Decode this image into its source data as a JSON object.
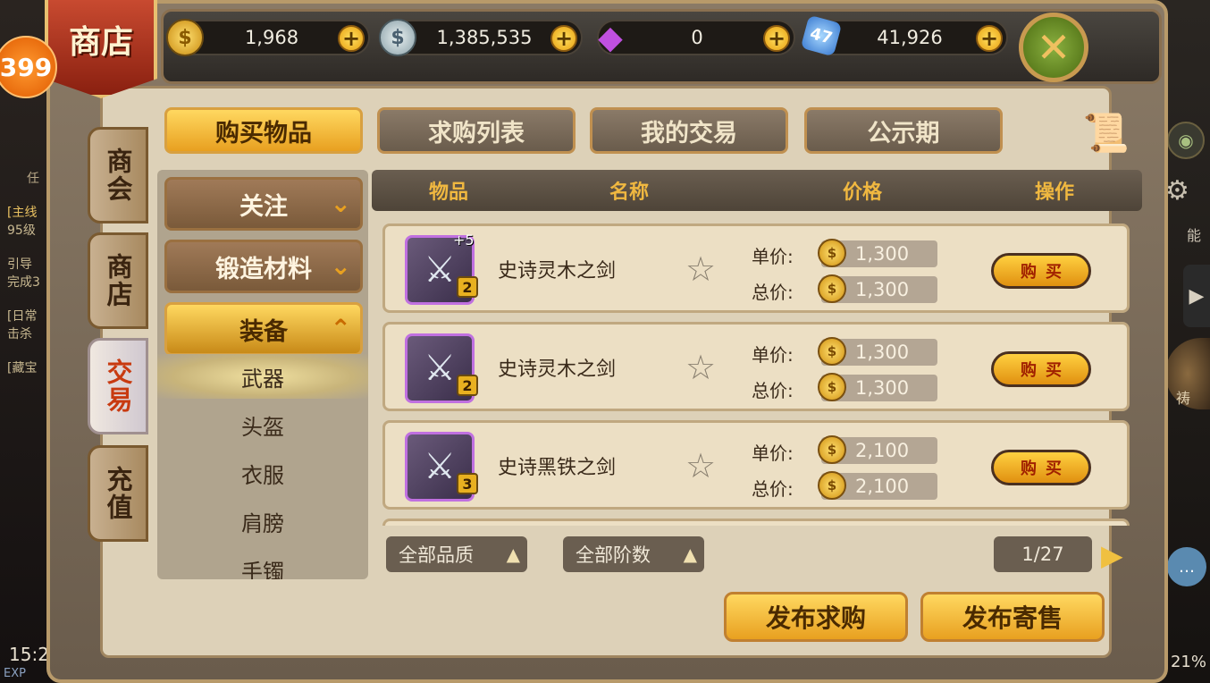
{
  "background": {
    "quests": [
      "[主线",
      "95级",
      "引导",
      "完成3",
      "[日常",
      "击杀",
      "[藏宝"
    ],
    "quest_tab": "任",
    "time": "15:2",
    "exp_label": "EXP",
    "percent": "21%",
    "right_label_1": "能",
    "right_label_2": "祷"
  },
  "banner": {
    "title": "商店",
    "badge": "399"
  },
  "currencies": [
    {
      "icon": "gold-coin-icon",
      "symbol": "$",
      "value": "1,968"
    },
    {
      "icon": "silver-coin-icon",
      "symbol": "$",
      "value": "1,385,535"
    },
    {
      "icon": "gem-icon",
      "symbol": "◆",
      "value": "0"
    },
    {
      "icon": "crystal-icon",
      "symbol": "47",
      "value": "41,926"
    }
  ],
  "side_tabs": [
    "商会",
    "商店",
    "交易",
    "充值"
  ],
  "top_tabs": [
    "购买物品",
    "求购列表",
    "我的交易",
    "公示期"
  ],
  "categories": [
    {
      "label": "关注",
      "state": "closed"
    },
    {
      "label": "锻造材料",
      "state": "closed"
    },
    {
      "label": "装备",
      "state": "open"
    }
  ],
  "subcategories": [
    "武器",
    "头盔",
    "衣服",
    "肩膀",
    "手镯"
  ],
  "table_headers": [
    "物品",
    "名称",
    "价格",
    "操作"
  ],
  "price_labels": {
    "unit": "单价:",
    "total": "总价:"
  },
  "rows": [
    {
      "name": "史诗灵木之剑",
      "level": "2",
      "plus": "+5",
      "unit_price": "1,300",
      "total_price": "1,300"
    },
    {
      "name": "史诗灵木之剑",
      "level": "2",
      "plus": "",
      "unit_price": "1,300",
      "total_price": "1,300"
    },
    {
      "name": "史诗黑铁之剑",
      "level": "3",
      "plus": "",
      "unit_price": "2,100",
      "total_price": "2,100"
    }
  ],
  "buy_label": "购买",
  "filters": {
    "quality": "全部品质",
    "tier": "全部阶数"
  },
  "pager": "1/27",
  "actions": {
    "post_request": "发布求购",
    "post_sale": "发布寄售"
  },
  "colors": {
    "accent_gold": "#e8a020",
    "active_tab_text": "#c83a10",
    "item_border_epic": "#c070e0"
  }
}
